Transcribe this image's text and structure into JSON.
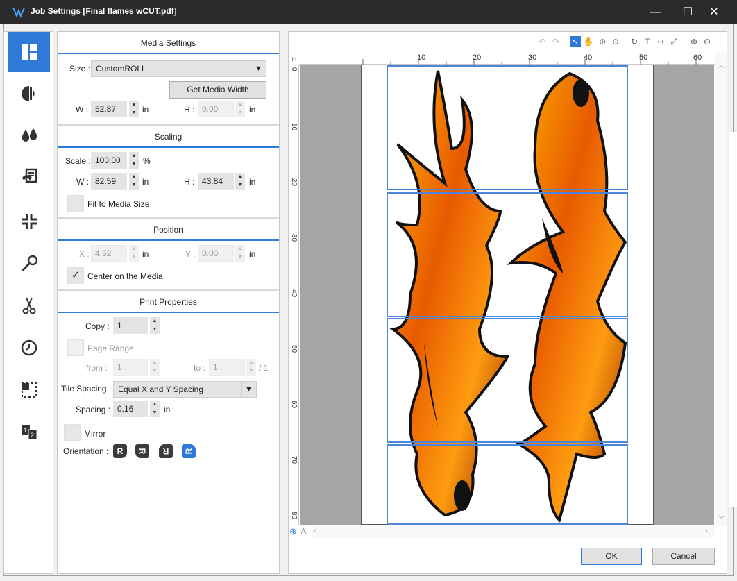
{
  "window": {
    "title": "Job Settings [Final flames wCUT.pdf]",
    "controls": [
      "—",
      "☐",
      "✕"
    ]
  },
  "rail": {
    "items": [
      {
        "name": "layout",
        "active": true
      },
      {
        "name": "color"
      },
      {
        "name": "ink"
      },
      {
        "name": "replace"
      },
      {
        "name": "shrink"
      },
      {
        "name": "tools"
      },
      {
        "name": "cut"
      },
      {
        "name": "time"
      },
      {
        "name": "crop"
      },
      {
        "name": "tiling"
      }
    ]
  },
  "media": {
    "header": "Media Settings",
    "size_label": "Size :",
    "size_value": "CustomROLL",
    "get_width": "Get Media Width",
    "w_label": "W :",
    "w_value": "52.87",
    "w_unit": "in",
    "h_label": "H :",
    "h_value": "0.00",
    "h_unit": "in"
  },
  "scaling": {
    "header": "Scaling",
    "scale_label": "Scale :",
    "scale_value": "100.00",
    "scale_unit": "%",
    "w_label": "W :",
    "w_value": "82.59",
    "w_unit": "in",
    "h_label": "H :",
    "h_value": "43.84",
    "h_unit": "in",
    "fit_label": "Fit to Media Size"
  },
  "position": {
    "header": "Position",
    "x_label": "X :",
    "x_value": "4.52",
    "x_unit": "in",
    "y_label": "Y :",
    "y_value": "0.00",
    "y_unit": "in",
    "center_label": "Center on the Media",
    "center_checked": "✓"
  },
  "print": {
    "header": "Print Properties",
    "copy_label": "Copy :",
    "copy_value": "1",
    "page_range_label": "Page Range",
    "from_label": "from :",
    "from_value": "1",
    "to_label": "to :",
    "to_value": "1",
    "to_total": "/ 1",
    "tile_spacing_label": "Tile Spacing :",
    "tile_spacing_value": "Equal X and Y Spacing",
    "spacing_label": "Spacing :",
    "spacing_value": "0.16",
    "spacing_unit": "in",
    "mirror_label": "Mirror",
    "orientation_label": "Orientation :",
    "orientations": [
      "R",
      "R",
      "R",
      "R"
    ]
  },
  "preview": {
    "unit": "in",
    "ruler_h": [
      "10",
      "20",
      "30",
      "40",
      "50",
      "60"
    ],
    "ruler_v": [
      "0",
      "10",
      "20",
      "30",
      "40",
      "50",
      "60",
      "70",
      "80"
    ]
  },
  "footer": {
    "ok": "OK",
    "cancel": "Cancel"
  }
}
